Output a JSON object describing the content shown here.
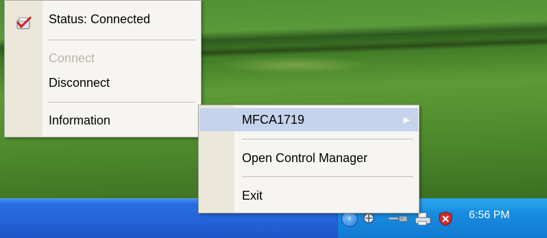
{
  "tray_menu": {
    "status_label": "Status: Connected",
    "connect_label": "Connect",
    "disconnect_label": "Disconnect",
    "information_label": "Information"
  },
  "submenu": {
    "device_label": "MFCA1719",
    "open_control_manager_label": "Open Control Manager",
    "exit_label": "Exit"
  },
  "taskbar": {
    "clock": "6:56 PM"
  },
  "icons": {
    "status": "status-connected-icon",
    "chevron": "tray-expand-chevron-icon",
    "network": "network-icon",
    "connection": "modem-connection-icon",
    "printer": "printer-icon",
    "security": "security-shield-icon",
    "submenu_arrow": "submenu-arrow-icon"
  },
  "colors": {
    "menu_background": "#f6f5f1",
    "menu_gutter": "#ebe8d9",
    "highlight": "#c6d3ec",
    "taskbar_blue": "#2563d9",
    "tray_blue": "#178bdf",
    "disabled_text": "#b9b7ae"
  }
}
